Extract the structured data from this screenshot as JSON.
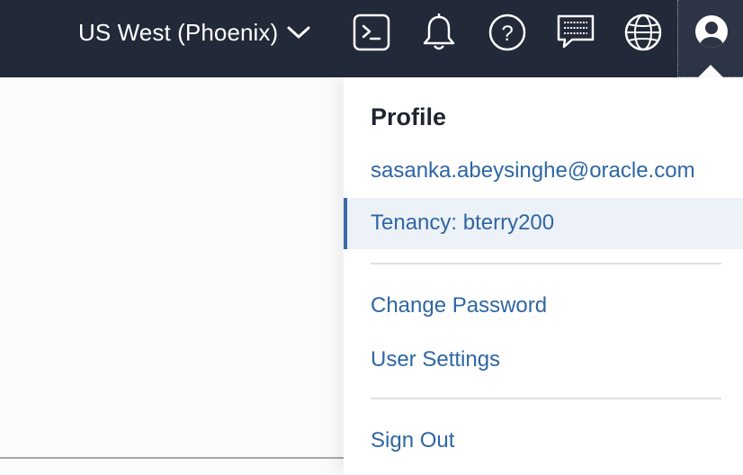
{
  "topbar": {
    "region_label": "US West (Phoenix)",
    "icons": [
      "chevron-down-icon",
      "cloud-shell-icon",
      "bell-icon",
      "help-icon",
      "chat-icon",
      "globe-icon",
      "user-avatar-icon"
    ]
  },
  "profile_menu": {
    "title": "Profile",
    "email": "sasanka.abeysinghe@oracle.com",
    "tenancy": "Tenancy: bterry200",
    "change_password": "Change Password",
    "user_settings": "User Settings",
    "sign_out": "Sign Out"
  },
  "colors": {
    "topbar_bg": "#222938",
    "link": "#2e66a4",
    "active_bg": "#edf2f8",
    "active_border": "#3b6aa8"
  }
}
